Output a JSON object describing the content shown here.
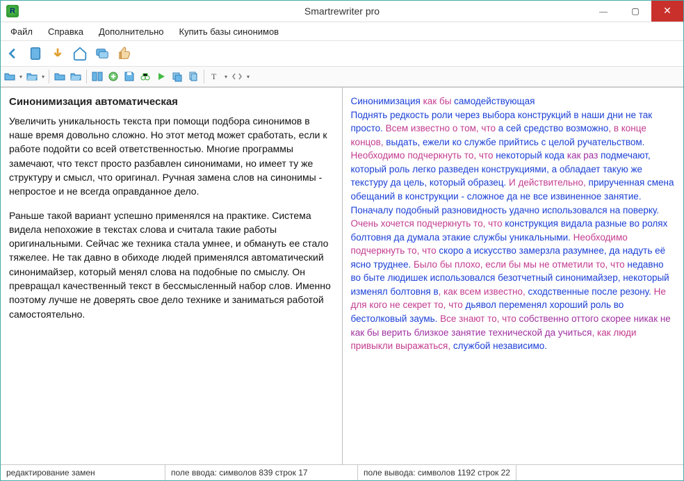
{
  "title": "Smartrewriter pro",
  "win": {
    "min": "—",
    "max": "▢",
    "close": "✕"
  },
  "menu": {
    "file": "Файл",
    "help": "Справка",
    "extra": "Дополнительно",
    "buy": "Купить базы синонимов"
  },
  "left": {
    "heading": "Синонимизация автоматическая",
    "p1": "Увеличить уникальность текста при помощи подбора синонимов в наше время довольно сложно. Но этот метод может сработать, если к работе подойти со всей ответственностью. Многие программы замечают, что текст просто разбавлен синонимами, но имеет ту же структуру и смысл, что оригинал. Ручная замена слов на синонимы - непростое и не всегда оправданное дело.",
    "p2": "Раньше такой вариант успешно применялся на практике. Система видела непохожие в текстах слова и считала такие работы оригинальными. Сейчас же техника стала умнее, и обмануть ее стало тяжелее. Не так давно в обиходе людей применялся автоматический синонимайзер, который менял слова на подобные по смыслу. Он превращал качественный текст в бессмысленный набор слов. Именно поэтому лучше не доверять свое дело технике и заниматься работой самостоятельно."
  },
  "right": {
    "t1a": "Синонимизация ",
    "t1b": "как бы ",
    "t1c": "самодействующая",
    "t2a": "Поднять редкость роли через выбора конструкций в наши дни не так просто.",
    "t2b": " Всем известно о том, что ",
    "t2c": "а сей средство возможно",
    "t2d": ", в конце концов, ",
    "t2e": "выдать, ежели ко службе прийтись с целой ручательством.",
    "t2f": " Необходимо подчеркнуть то, что ",
    "t2g": "некоторый кода ",
    "t2h": "как раз ",
    "t2i": "подмечают, который роль легко разведен конструкциями, а обладает такую же текстуру да цель, который образец.",
    "t2j": " И действительно, ",
    "t2k": "прирученная смена обещаний в конструкции - сложное да не все извиненное занятие.",
    "t3a": "Поначалу подобный разновидность удачно использовался на поверку.",
    "t3b": " Очень хочется подчеркнуть то, что ",
    "t3c": "конструкция видала разные во ролях болтовня да думала этакие службы уникальными.",
    "t3d": " Необходимо подчеркнуть то, что ",
    "t3e": "скоро а искусство замерзла разумнее, да надуть её ясно труднее.",
    "t3f": " Было бы плохо, если бы мы не отметили то, что ",
    "t3g": "недавно во быте людишек использовался безотчетный синонимайзер, некоторый изменял болтовня в",
    "t3h": ", как всем известно, ",
    "t3i": "сходственные после резону.",
    "t3j": " Не для кого не секрет то, что ",
    "t3k": "дьявол переменял хороший роль во бестолковый заумь.",
    "t3l": " Все знают то, что ",
    "t3m": "собственно оттого скорее никак не как бы верить близкое занятие технической да учиться",
    "t3n": ", как люди привыкли выражаться, ",
    "t3o": "службой независимо."
  },
  "status": {
    "s1": "редактирование замен",
    "s2": "поле ввода: символов 839 строк 17",
    "s3": "поле вывода: символов 1192 строк 22"
  }
}
